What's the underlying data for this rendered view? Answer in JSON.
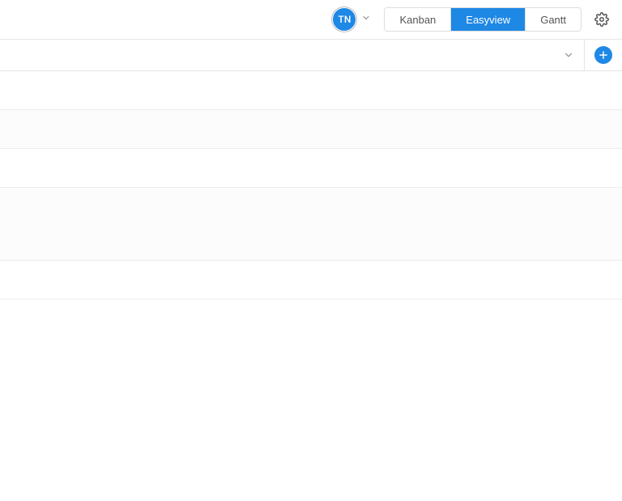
{
  "header": {
    "avatar_initials": "TN",
    "view_tabs": [
      {
        "label": "Kanban",
        "active": false
      },
      {
        "label": "Easyview",
        "active": true
      },
      {
        "label": "Gantt",
        "active": false
      }
    ]
  }
}
